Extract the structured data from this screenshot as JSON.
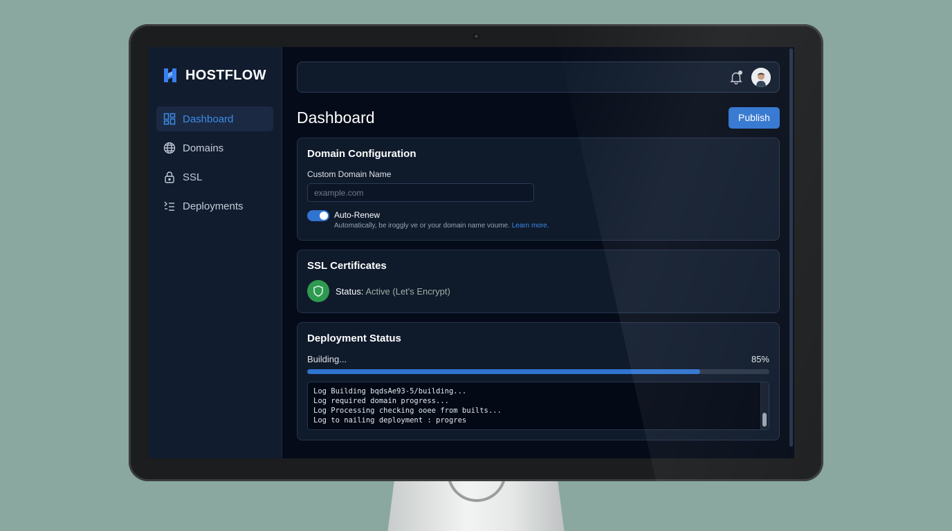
{
  "app": {
    "brand": "HOSTFLOW"
  },
  "sidebar": {
    "items": [
      {
        "label": "Dashboard",
        "icon": "grid-icon",
        "active": true
      },
      {
        "label": "Domains",
        "icon": "globe-icon",
        "active": false
      },
      {
        "label": "SSL",
        "icon": "lock-icon",
        "active": false
      },
      {
        "label": "Deployments",
        "icon": "deployments-icon",
        "active": false
      }
    ]
  },
  "header": {
    "title": "Dashboard",
    "publish_label": "Publish"
  },
  "domain_config": {
    "title": "Domain Configuration",
    "field_label": "Custom Domain Name",
    "placeholder": "example.com",
    "toggle_label": "Auto-Renew",
    "toggle_on": true,
    "description": "Automatically, be iroggly ve or your domain name voume.",
    "learn_more": "Learn more."
  },
  "ssl": {
    "title": "SSL Certificates",
    "status_label": "Status:",
    "status_value": "Active (Let's Encrypt)"
  },
  "deployment": {
    "title": "Deployment Status",
    "state": "Building...",
    "percent_label": "85%",
    "progress": 0.85,
    "logs": [
      "Log Building bqdsAe93-5/building...",
      "Log required domain progress...",
      "Log Processing checking ooee from builts...",
      "Log to nailing deployment : progres"
    ]
  },
  "colors": {
    "accent": "#2f74d0",
    "success": "#2e9a4f",
    "background": "#050b18"
  }
}
